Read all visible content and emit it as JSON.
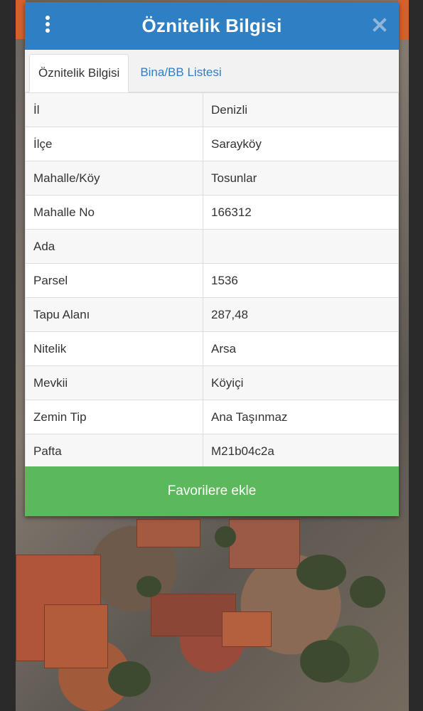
{
  "dialog": {
    "title": "Öznitelik Bilgisi",
    "header_color": "#2f7fc4",
    "menu_icon": "vertical-ellipsis-icon",
    "close_icon": "close-icon"
  },
  "tabs": [
    {
      "label": "Öznitelik Bilgisi",
      "active": true
    },
    {
      "label": "Bina/BB Listesi",
      "active": false
    }
  ],
  "attributes": [
    {
      "key": "İl",
      "value": "Denizli"
    },
    {
      "key": "İlçe",
      "value": "Sarayköy"
    },
    {
      "key": "Mahalle/Köy",
      "value": "Tosunlar"
    },
    {
      "key": "Mahalle No",
      "value": "166312"
    },
    {
      "key": "Ada",
      "value": ""
    },
    {
      "key": "Parsel",
      "value": "1536"
    },
    {
      "key": "Tapu Alanı",
      "value": "287,48"
    },
    {
      "key": "Nitelik",
      "value": "Arsa"
    },
    {
      "key": "Mevkii",
      "value": "Köyiçi"
    },
    {
      "key": "Zemin Tip",
      "value": "Ana Taşınmaz"
    },
    {
      "key": "Pafta",
      "value": "M21b04c2a"
    }
  ],
  "favorite_button": {
    "label": "Favorilere ekle",
    "color": "#5cb85c"
  }
}
